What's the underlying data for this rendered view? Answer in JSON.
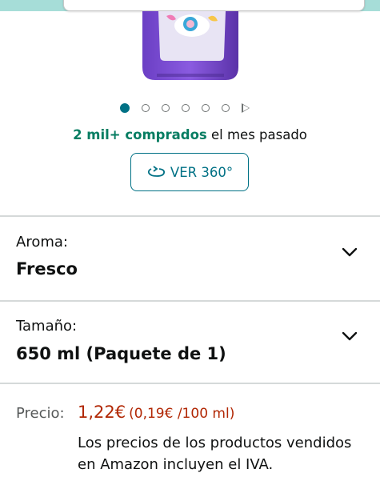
{
  "gallery": {
    "dot_count": 6,
    "active_index": 0
  },
  "social_proof": {
    "strong": "2 mil+ comprados",
    "rest": " el mes pasado"
  },
  "view360": {
    "label": "VER 360°",
    "icon": "rotate-360-icon"
  },
  "variants": [
    {
      "label": "Aroma:",
      "value": "Fresco",
      "icon": "chevron-down-icon"
    },
    {
      "label": "Tamaño:",
      "value": "650 ml (Paquete de 1)",
      "icon": "chevron-down-icon"
    }
  ],
  "price": {
    "label": "Precio:",
    "amount": "1,22€",
    "unit_price": "(0,19€ /100 ml)",
    "vat_note": "Los precios de los productos vendidos en Amazon incluyen el IVA."
  },
  "colors": {
    "accent_teal": "#007185",
    "bought_green": "#067d62",
    "price_red": "#b12704",
    "header_band": "#a6ddd8"
  }
}
